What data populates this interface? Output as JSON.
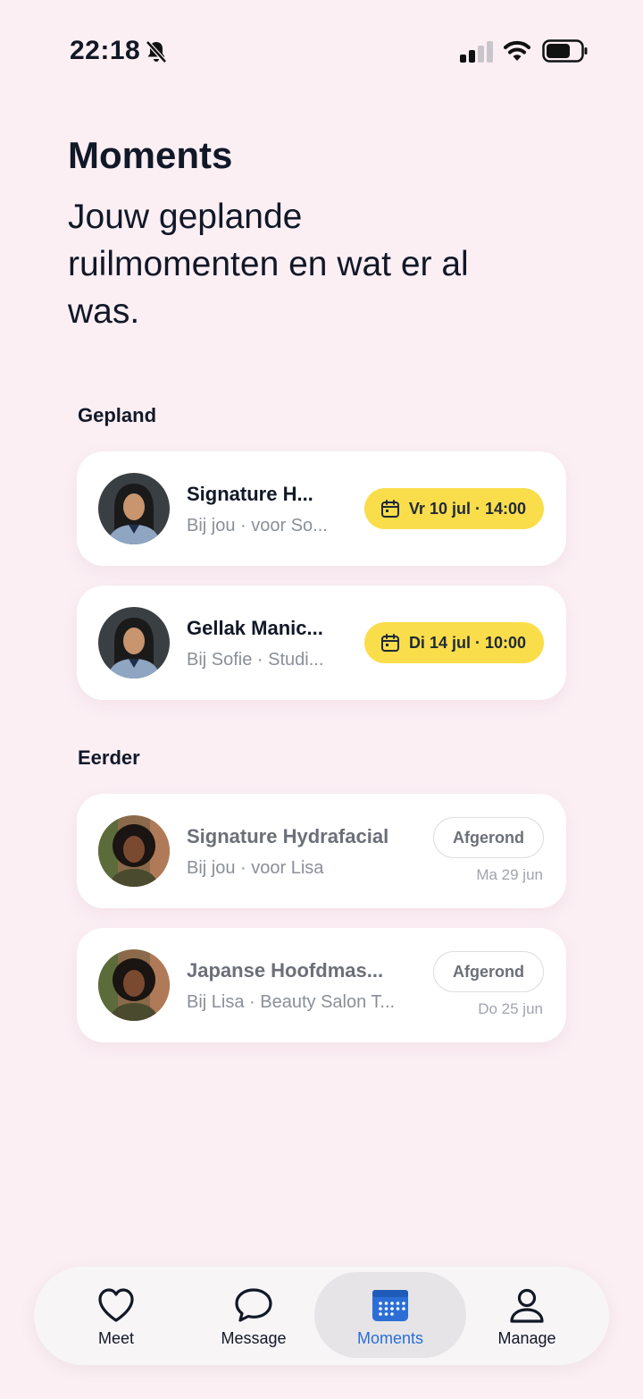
{
  "status_bar": {
    "time": "22:18"
  },
  "header": {
    "title": "Moments",
    "subtitle": "Jouw geplande ruilmomenten en wat er al was."
  },
  "sections": {
    "planned": {
      "label": "Gepland",
      "items": [
        {
          "title": "Signature H...",
          "subtitle": "Bij jou · voor So...",
          "date": "Vr 10 jul · 14:00"
        },
        {
          "title": "Gellak Manic...",
          "subtitle": "Bij Sofie · Studi...",
          "date": "Di 14 jul · 10:00"
        }
      ]
    },
    "past": {
      "label": "Eerder",
      "items": [
        {
          "title": "Signature Hydrafacial",
          "subtitle": "Bij jou · voor Lisa",
          "status": "Afgerond",
          "date": "Ma 29 jun"
        },
        {
          "title": "Japanse Hoofdmas...",
          "subtitle": "Bij Lisa · Beauty Salon T...",
          "status": "Afgerond",
          "date": "Do 25 jun"
        }
      ]
    }
  },
  "tab_bar": {
    "tabs": [
      {
        "label": "Meet",
        "icon": "heart-icon"
      },
      {
        "label": "Message",
        "icon": "chat-bubble-icon"
      },
      {
        "label": "Moments",
        "icon": "calendar-icon",
        "active": true
      },
      {
        "label": "Manage",
        "icon": "user-icon"
      }
    ]
  },
  "colors": {
    "background": "#fbeff4",
    "accent_yellow": "#fadd4a",
    "active_tab": "#2b6fd6"
  }
}
